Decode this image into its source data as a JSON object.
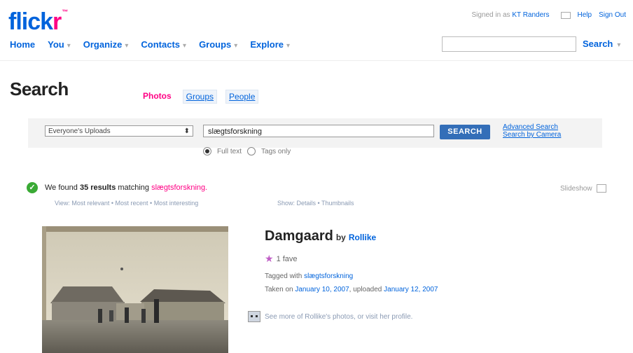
{
  "logo": {
    "part1": "flick",
    "part2": "r",
    "tm": "™"
  },
  "topbar": {
    "signed_in": "Signed in as",
    "user": "KT Randers",
    "help": "Help",
    "signout": "Sign Out"
  },
  "nav": {
    "items": [
      "Home",
      "You",
      "Organize",
      "Contacts",
      "Groups",
      "Explore"
    ]
  },
  "top_search": {
    "button": "Search",
    "value": ""
  },
  "page": {
    "title": "Search"
  },
  "tabs": {
    "photos": "Photos",
    "groups": "Groups",
    "people": "People"
  },
  "search": {
    "scope": "Everyone's Uploads",
    "query": "slægtsforskning",
    "button": "SEARCH",
    "advanced": "Advanced Search",
    "camera": "Search by Camera",
    "opt_full": "Full text",
    "opt_tags": "Tags only"
  },
  "results": {
    "found_prefix": "We found",
    "count": "35 results",
    "matching": "matching",
    "query": "slægtsforskning.",
    "view_line": "View: Most relevant • Most recent • Most interesting",
    "show_line": "Show: Details • Thumbnails",
    "slideshow": "Slideshow"
  },
  "result": {
    "title": "Damgaard",
    "by": "by",
    "owner": "Rollike",
    "faves": "1 fave",
    "tagged_prefix": "Tagged with",
    "tag": "slægtsforskning",
    "taken_prefix": "Taken on",
    "taken_date": "January 10, 2007",
    "uploaded_prefix": ", uploaded",
    "uploaded_date": "January 12, 2007",
    "more": "See more of Rollike's photos, or visit her profile."
  }
}
